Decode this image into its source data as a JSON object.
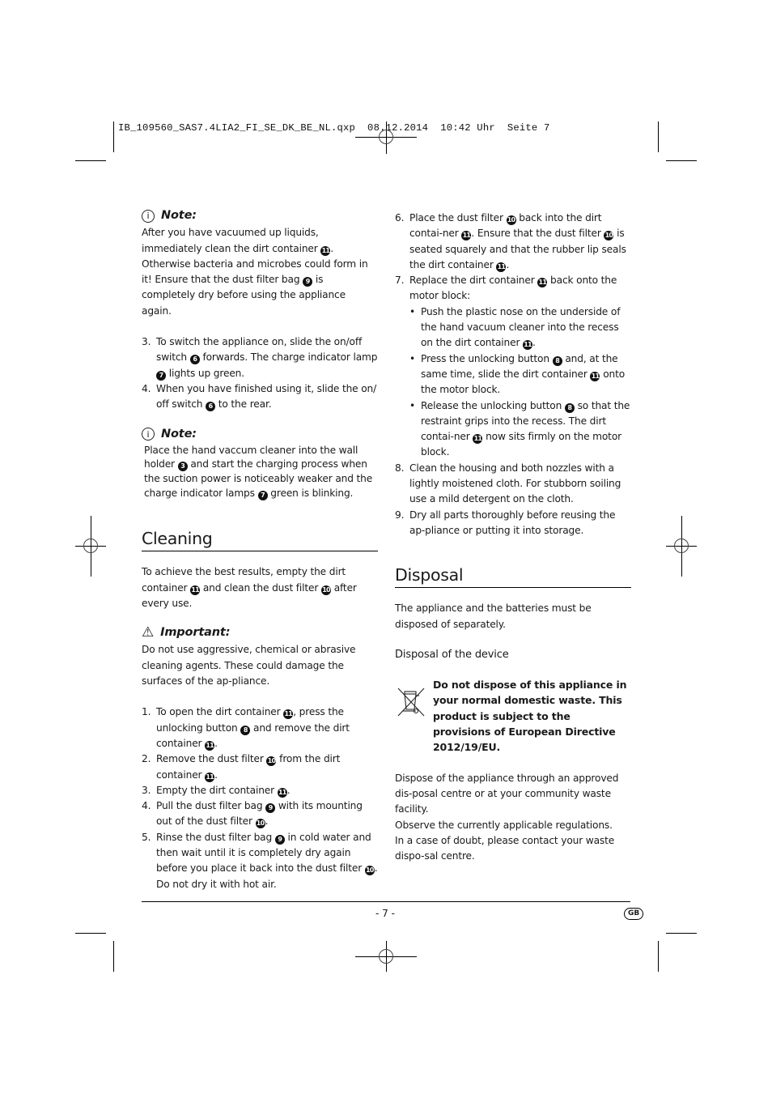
{
  "slug": "IB_109560_SAS7.4LIA2_FI_SE_DK_BE_NL.qxp  08.12.2014  10:42 Uhr  Seite 7",
  "left": {
    "note1": {
      "title": "Note:",
      "icon": "info-icon",
      "text": [
        {
          "t": "After you have vacuumed up liquids, immediately clean the dirt container "
        },
        {
          "n": "11"
        },
        {
          "t": ". Otherwise bacteria and microbes could form in it! Ensure that the dust filter bag "
        },
        {
          "n": "9"
        },
        {
          "t": " is completely dry before using the appliance again."
        }
      ]
    },
    "steps_a": [
      {
        "num": "3.",
        "parts": [
          {
            "t": "To switch the appliance on, slide the on/off switch "
          },
          {
            "n": "6"
          },
          {
            "t": " forwards. The charge indicator lamp "
          },
          {
            "n": "7"
          },
          {
            "t": " lights up green."
          }
        ]
      },
      {
        "num": "4.",
        "parts": [
          {
            "t": "When you have finished using it, slide the on/ off switch "
          },
          {
            "n": "6"
          },
          {
            "t": " to the rear."
          }
        ]
      }
    ],
    "note2": {
      "title": "Note:",
      "icon": "info-icon",
      "text": [
        {
          "t": "Place the hand vaccum cleaner into the wall holder "
        },
        {
          "n": "3"
        },
        {
          "t": " and start the charging process when the suction power is noticeably weaker and the charge indicator lamps "
        },
        {
          "n": "7"
        },
        {
          "t": " green is blinking."
        }
      ]
    },
    "cleaning": {
      "title": "Cleaning",
      "intro": [
        {
          "t": "To achieve the best results, empty the dirt container "
        },
        {
          "n": "11"
        },
        {
          "t": " and clean the dust filter "
        },
        {
          "n": "10"
        },
        {
          "t": " after every use."
        }
      ],
      "important": {
        "title": "Important:",
        "icon": "warning-icon",
        "text": "Do not use aggressive, chemical or abrasive cleaning agents. These could damage the surfaces of the ap-pliance."
      },
      "steps": [
        {
          "num": "1.",
          "parts": [
            {
              "t": "To open the dirt container "
            },
            {
              "n": "11"
            },
            {
              "t": ", press the unlocking button "
            },
            {
              "n": "8"
            },
            {
              "t": " and remove the dirt container "
            },
            {
              "n": "11"
            },
            {
              "t": "."
            }
          ]
        },
        {
          "num": "2.",
          "parts": [
            {
              "t": "Remove the dust filter "
            },
            {
              "n": "10"
            },
            {
              "t": " from the dirt container "
            },
            {
              "n": "11"
            },
            {
              "t": "."
            }
          ]
        },
        {
          "num": "3.",
          "parts": [
            {
              "t": "Empty the dirt container "
            },
            {
              "n": "11"
            },
            {
              "t": "."
            }
          ]
        },
        {
          "num": "4.",
          "parts": [
            {
              "t": "Pull the dust filter bag "
            },
            {
              "n": "9"
            },
            {
              "t": " with its mounting out of the dust filter "
            },
            {
              "n": "10"
            },
            {
              "t": "."
            }
          ]
        },
        {
          "num": "5.",
          "parts": [
            {
              "t": "Rinse the dust filter bag "
            },
            {
              "n": "9"
            },
            {
              "t": " in cold water and then wait until it is completely dry again before you place it back into the dust filter "
            },
            {
              "n": "10"
            },
            {
              "t": ". Do not dry it with hot air."
            }
          ]
        }
      ]
    }
  },
  "right": {
    "steps": [
      {
        "num": "6.",
        "parts": [
          {
            "t": "Place the dust filter "
          },
          {
            "n": "10"
          },
          {
            "t": " back into the dirt contai-ner "
          },
          {
            "n": "11"
          },
          {
            "t": ". Ensure that the dust filter "
          },
          {
            "n": "10"
          },
          {
            "t": " is seated squarely and that the rubber lip seals the dirt container "
          },
          {
            "n": "11"
          },
          {
            "t": "."
          }
        ]
      },
      {
        "num": "7.",
        "parts": [
          {
            "t": "Replace the dirt container "
          },
          {
            "n": "11"
          },
          {
            "t": " back onto the motor block:"
          }
        ],
        "bullets": [
          [
            {
              "t": "Push the plastic nose on the underside of the hand vacuum cleaner into the recess on the dirt container "
            },
            {
              "n": "11"
            },
            {
              "t": "."
            }
          ],
          [
            {
              "t": "Press the unlocking button "
            },
            {
              "n": "8"
            },
            {
              "t": " and, at the same time, slide the dirt container "
            },
            {
              "n": "11"
            },
            {
              "t": " onto the motor block."
            }
          ],
          [
            {
              "t": "Release the unlocking button "
            },
            {
              "n": "8"
            },
            {
              "t": " so that the restraint grips into the recess. The dirt contai-ner "
            },
            {
              "n": "11"
            },
            {
              "t": " now sits firmly on the motor block."
            }
          ]
        ]
      },
      {
        "num": "8.",
        "parts": [
          {
            "t": "Clean the housing and both nozzles with a lightly moistened cloth. For stubborn soiling use a mild detergent on the cloth."
          }
        ]
      },
      {
        "num": "9.",
        "parts": [
          {
            "t": "Dry all parts thoroughly before reusing the ap-pliance or putting it into storage."
          }
        ]
      }
    ],
    "disposal": {
      "title": "Disposal",
      "intro": "The appliance and the batteries must be disposed of separately.",
      "subhead": "Disposal of the device",
      "icon": "crossed-out-wheelie-bin-icon",
      "warning": "Do not dispose of this appliance in your normal domestic waste. This product is subject to the provisions of European Directive 2012/19/EU.",
      "body": [
        "Dispose of the appliance through an approved dis-posal centre or at your community waste facility.",
        "Observe the currently applicable regulations.",
        "In a case of doubt, please contact your waste dispo-sal centre."
      ]
    }
  },
  "footer": {
    "page_number": "- 7 -",
    "country_badge": "GB"
  }
}
